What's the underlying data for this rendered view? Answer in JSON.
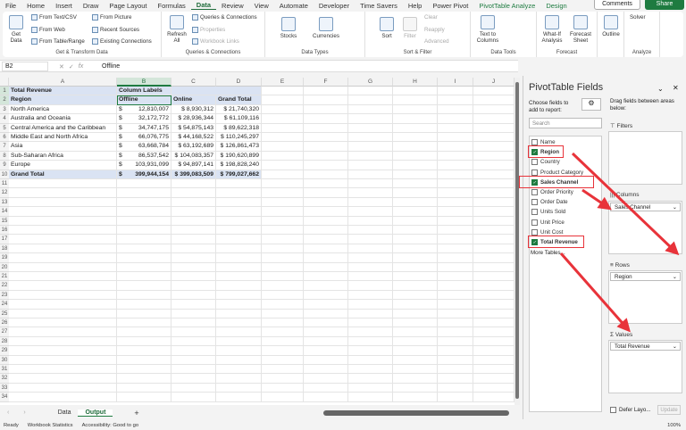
{
  "menu": [
    "File",
    "Home",
    "Insert",
    "Draw",
    "Page Layout",
    "Formulas",
    "Data",
    "Review",
    "View",
    "Automate",
    "Developer",
    "Time Savers",
    "Help",
    "Power Pivot",
    "PivotTable Analyze",
    "Design"
  ],
  "active_menu": "Data",
  "comments": "Comments",
  "share": "Share",
  "ribbon": {
    "get_data": "Get Data",
    "from_text": "From Text/CSV",
    "from_web": "From Web",
    "from_table": "From Table/Range",
    "from_picture": "From Picture",
    "recent_sources": "Recent Sources",
    "existing_connections": "Existing Connections",
    "get_transform": "Get & Transform Data",
    "refresh_all": "Refresh All",
    "queries_connections": "Queries & Connections",
    "properties": "Properties",
    "workbook_links": "Workbook Links",
    "qc_group": "Queries & Connections",
    "stocks": "Stocks",
    "currencies": "Currencies",
    "data_types": "Data Types",
    "sort": "Sort",
    "filter": "Filter",
    "clear": "Clear",
    "reapply": "Reapply",
    "advanced": "Advanced",
    "sort_filter": "Sort & Filter",
    "text_to_columns": "Text to Columns",
    "data_tools": "Data Tools",
    "what_if": "What-If Analysis",
    "forecast_sheet": "Forecast Sheet",
    "forecast": "Forecast",
    "outline": "Outline",
    "solver": "Solver",
    "analyze": "Analyze"
  },
  "name_box": "B2",
  "formula": "Offline",
  "columns": [
    "A",
    "B",
    "C",
    "D",
    "E",
    "F",
    "G",
    "H",
    "I",
    "J"
  ],
  "pivot": {
    "title": "Total Revenue",
    "column_labels": "Column Labels",
    "row_header": "Region",
    "col_headers": [
      "Offline",
      "Online",
      "Grand Total"
    ],
    "rows": [
      [
        "North America",
        "$",
        "12,810,007",
        "$    8,930,312",
        "$   21,740,320"
      ],
      [
        "Australia and Oceania",
        "$",
        "32,172,772",
        "$  28,936,344",
        "$   61,109,116"
      ],
      [
        "Central America and the Caribbean",
        "$",
        "34,747,175",
        "$  54,875,143",
        "$   89,622,318"
      ],
      [
        "Middle East and North Africa",
        "$",
        "66,076,775",
        "$  44,168,522",
        "$ 110,245,297"
      ],
      [
        "Asia",
        "$",
        "63,668,784",
        "$  63,192,689",
        "$ 126,861,473"
      ],
      [
        "Sub-Saharan Africa",
        "$",
        "86,537,542",
        "$ 104,083,357",
        "$ 190,620,899"
      ],
      [
        "Europe",
        "$",
        "103,931,099",
        "$  94,897,141",
        "$ 198,828,240"
      ]
    ],
    "grand_total": [
      "Grand Total",
      "$",
      "399,944,154",
      "$ 399,083,509",
      "$ 799,027,662"
    ]
  },
  "sheets": [
    "Data",
    "Output"
  ],
  "active_sheet": "Output",
  "status": {
    "ready": "Ready",
    "stats": "Workbook Statistics",
    "accessibility": "Accessibility: Good to go",
    "zoom": "100%"
  },
  "pane": {
    "title": "PivotTable Fields",
    "choose": "Choose fields to add to report:",
    "drag": "Drag fields between areas below:",
    "search_placeholder": "Search",
    "fields": [
      {
        "name": "Name",
        "checked": false
      },
      {
        "name": "Region",
        "checked": true
      },
      {
        "name": "Country",
        "checked": false
      },
      {
        "name": "Product Category",
        "checked": false
      },
      {
        "name": "Sales Channel",
        "checked": true
      },
      {
        "name": "Order Priority",
        "checked": false
      },
      {
        "name": "Order Date",
        "checked": false
      },
      {
        "name": "Units Sold",
        "checked": false
      },
      {
        "name": "Unit Price",
        "checked": false
      },
      {
        "name": "Unit Cost",
        "checked": false
      },
      {
        "name": "Total Revenue",
        "checked": true
      }
    ],
    "more_tables": "More Tables...",
    "filters": "Filters",
    "columns": "Columns",
    "columns_item": "Sales Channel",
    "rows": "Rows",
    "rows_item": "Region",
    "values": "Values",
    "values_item": "Total Revenue",
    "defer": "Defer Layo...",
    "update": "Update"
  },
  "annotation_color": "#e8333a"
}
